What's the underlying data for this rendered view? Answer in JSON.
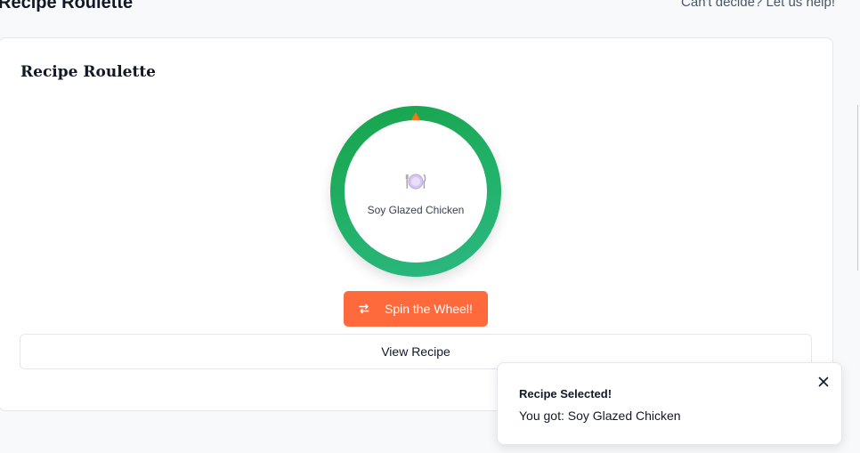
{
  "header": {
    "title": "Recipe Roulette",
    "tagline": "Can't decide? Let us help!"
  },
  "card": {
    "title": "Recipe Roulette",
    "wheel": {
      "current_recipe": "Soy Glazed Chicken",
      "center_icon": "plate-cutlery-icon",
      "pointer_color": "#f97316"
    },
    "spin_button": {
      "label": "Spin the Wheel!",
      "icon": "shuffle-arrows-icon",
      "color": "#ff6a3d"
    },
    "view_button": {
      "label": "View Recipe"
    }
  },
  "toast": {
    "title": "Recipe Selected!",
    "message": "You got: Soy Glazed Chicken",
    "close_icon": "close-icon"
  },
  "colors": {
    "wheel_green": "#17a34a",
    "accent_orange": "#ff6a3d"
  }
}
